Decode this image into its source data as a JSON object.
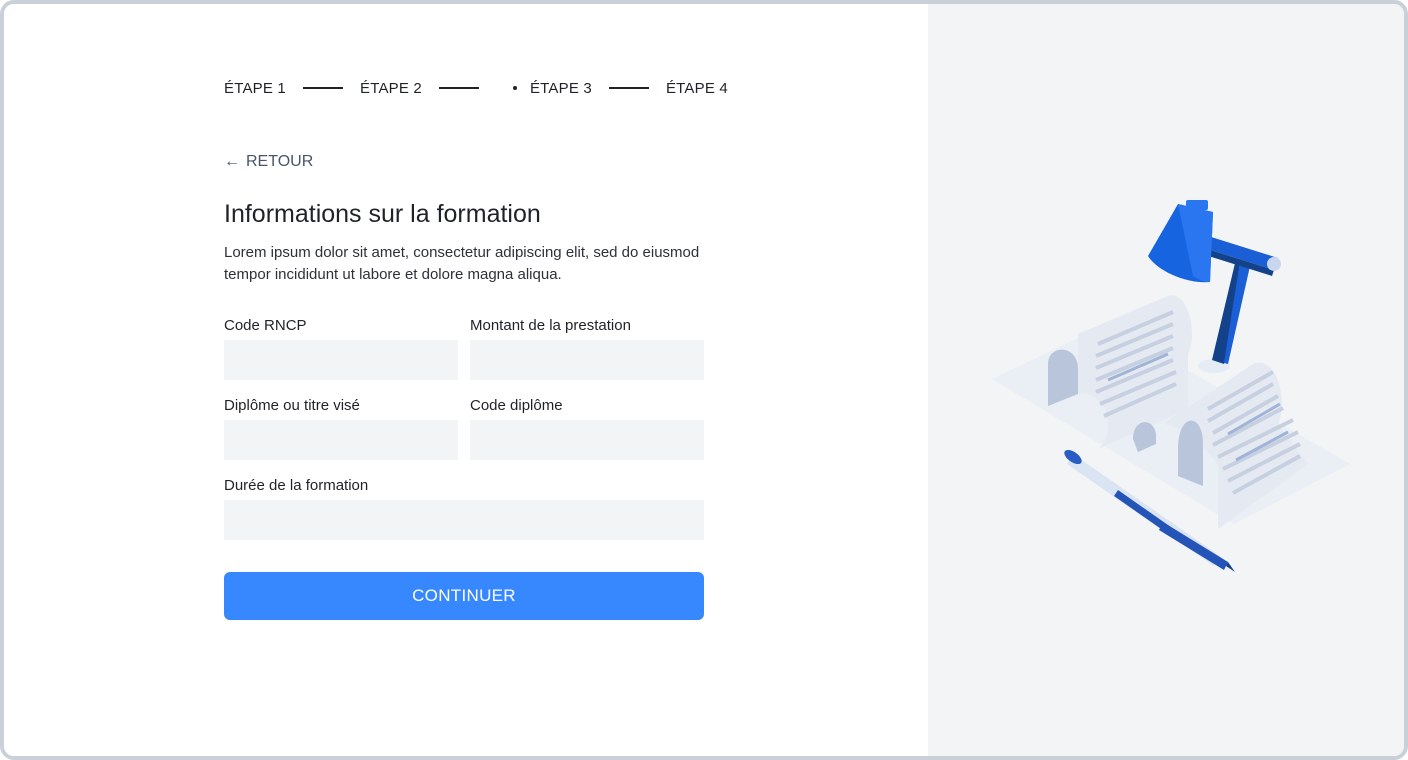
{
  "stepper": {
    "steps": [
      {
        "label": "ÉTAPE 1"
      },
      {
        "label": "ÉTAPE 2"
      },
      {
        "label": "ÉTAPE 3"
      },
      {
        "label": "ÉTAPE 4"
      }
    ]
  },
  "back": {
    "label": "RETOUR"
  },
  "header": {
    "title": "Informations sur la formation",
    "description": "Lorem ipsum dolor sit amet, consectetur adipiscing elit, sed do eiusmod tempor incididunt ut labore et dolore magna aliqua."
  },
  "form": {
    "rncp_label": "Code RNCP",
    "rncp_value": "",
    "amount_label": "Montant de la prestation",
    "amount_value": "",
    "diploma_label": "Diplôme ou titre visé",
    "diploma_value": "",
    "diploma_code_label": "Code diplôme",
    "diploma_code_value": "",
    "duration_label": "Durée de la formation",
    "duration_value": ""
  },
  "actions": {
    "continue_label": "CONTINUER"
  },
  "icons": {
    "back": "arrow-left-icon",
    "illustration": "desk-lamp-documents-pen-illustration"
  },
  "colors": {
    "primary": "#3787ff",
    "input_bg": "#f3f4f6",
    "side_bg": "#f3f4f6",
    "frame": "#c9d0d8"
  }
}
